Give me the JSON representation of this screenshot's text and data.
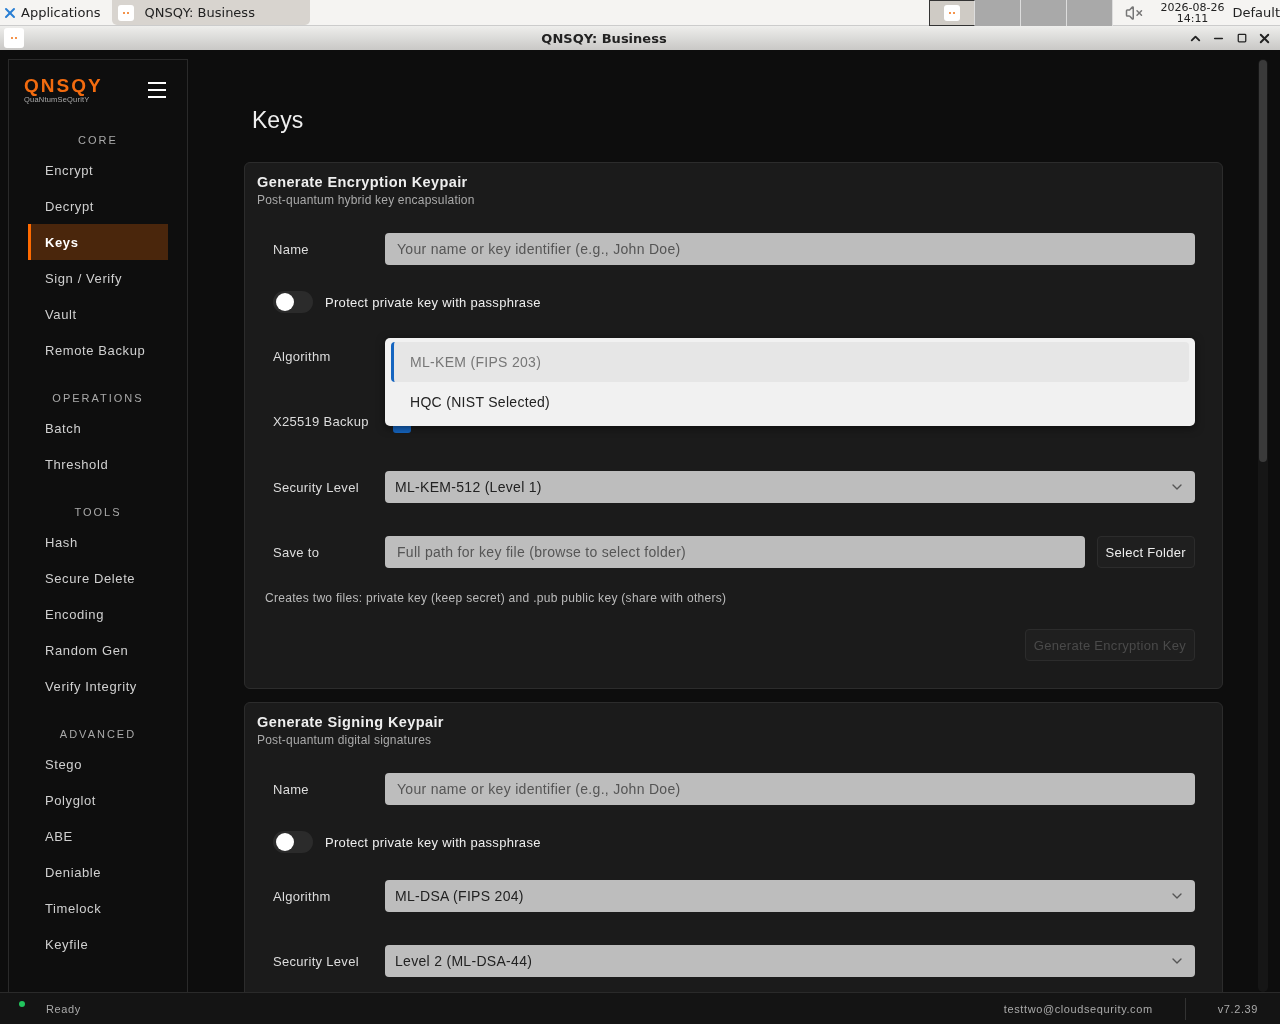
{
  "taskbar": {
    "apps_label": "Applications",
    "task": "QNSQY: Business",
    "date": "2026-08-26",
    "time": "14:11",
    "layout": "Default"
  },
  "window": {
    "title": "QNSQY: Business"
  },
  "sidebar": {
    "logo": "QNSQY",
    "tagline": "QuaNtumSeQuritY",
    "sections": [
      {
        "title": "CORE",
        "items": [
          {
            "label": "Encrypt",
            "selected": false
          },
          {
            "label": "Decrypt",
            "selected": false
          },
          {
            "label": "Keys",
            "selected": true
          },
          {
            "label": "Sign / Verify",
            "selected": false
          },
          {
            "label": "Vault",
            "selected": false
          },
          {
            "label": "Remote Backup",
            "selected": false
          }
        ]
      },
      {
        "title": "OPERATIONS",
        "items": [
          {
            "label": "Batch",
            "selected": false
          },
          {
            "label": "Threshold",
            "selected": false
          }
        ]
      },
      {
        "title": "TOOLS",
        "items": [
          {
            "label": "Hash",
            "selected": false
          },
          {
            "label": "Secure Delete",
            "selected": false
          },
          {
            "label": "Encoding",
            "selected": false
          },
          {
            "label": "Random Gen",
            "selected": false
          },
          {
            "label": "Verify Integrity",
            "selected": false
          }
        ]
      },
      {
        "title": "ADVANCED",
        "items": [
          {
            "label": "Stego",
            "selected": false
          },
          {
            "label": "Polyglot",
            "selected": false
          },
          {
            "label": "ABE",
            "selected": false
          },
          {
            "label": "Deniable",
            "selected": false
          },
          {
            "label": "Timelock",
            "selected": false
          },
          {
            "label": "Keyfile",
            "selected": false
          }
        ]
      }
    ]
  },
  "page": {
    "title": "Keys",
    "cards": [
      {
        "title": "Generate Encryption Keypair",
        "subtitle": "Post-quantum hybrid key encapsulation",
        "fields": [
          {
            "kind": "text",
            "label": "Name",
            "placeholder": "Your name or key identifier (e.g., John Doe)"
          },
          {
            "kind": "toggle",
            "label": "Protect private key with passphrase",
            "on": false
          },
          {
            "kind": "select",
            "label": "Algorithm",
            "options": [
              {
                "label": "ML-KEM (FIPS 203)",
                "selected": true
              },
              {
                "label": "HQC (NIST Selected)",
                "selected": false
              }
            ]
          },
          {
            "kind": "checkbox",
            "label": "X25519 Backup",
            "checked": true
          },
          {
            "kind": "select",
            "label": "Security Level",
            "value": "ML-KEM-512 (Level 1)"
          },
          {
            "kind": "path",
            "label": "Save to",
            "placeholder": "Full path for key file (browse to select folder)",
            "button": "Select Folder"
          }
        ],
        "note": "Creates two files: private key (keep secret) and .pub public key (share with others)",
        "action": {
          "label": "Generate Encryption Key",
          "disabled": true
        }
      },
      {
        "title": "Generate Signing Keypair",
        "subtitle": "Post-quantum digital signatures",
        "fields": [
          {
            "kind": "text",
            "label": "Name",
            "placeholder": "Your name or key identifier (e.g., John Doe)"
          },
          {
            "kind": "toggle",
            "label": "Protect private key with passphrase",
            "on": false
          },
          {
            "kind": "select",
            "label": "Algorithm",
            "value": "ML-DSA (FIPS 204)"
          },
          {
            "kind": "select",
            "label": "Security Level",
            "value": "Level 2 (ML-DSA-44)"
          }
        ]
      }
    ]
  },
  "status_bar": {
    "status": "Ready",
    "color": "#22c55e",
    "user": "testtwo@cloudsequrity.com",
    "version": "v7.2.39"
  }
}
